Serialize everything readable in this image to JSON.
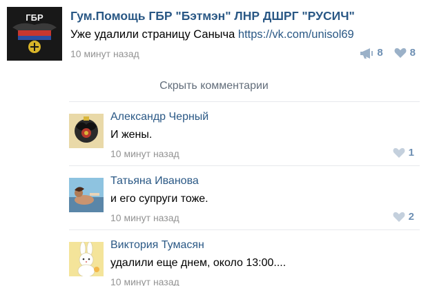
{
  "post": {
    "author": "Гум.Помощь ГБР \"Бэтмэн\" ЛНР ДШРГ \"РУСИЧ\"",
    "text": "Уже удалили страницу Саныча ",
    "link": "https://vk.com/unisol69",
    "time": "10 минут назад",
    "shares": "8",
    "likes": "8",
    "avatar_text": "ГБР"
  },
  "toggle_label": "Скрыть комментарии",
  "comments": [
    {
      "author": "Александр Черный",
      "text": "И жены.",
      "time": "10 минут назад",
      "likes": "1"
    },
    {
      "author": "Татьяна Иванова",
      "text": "и его супруги тоже.",
      "time": "10 минут назад",
      "likes": "2"
    },
    {
      "author": "Виктория Тумасян",
      "text": "удалили еще днем, около 13:00....",
      "time": "10 минут назад",
      "likes": ""
    }
  ],
  "colors": {
    "link": "#2a5885",
    "meta": "#939393",
    "icon": "#9bb1c8",
    "divider": "#e7e8ec"
  }
}
